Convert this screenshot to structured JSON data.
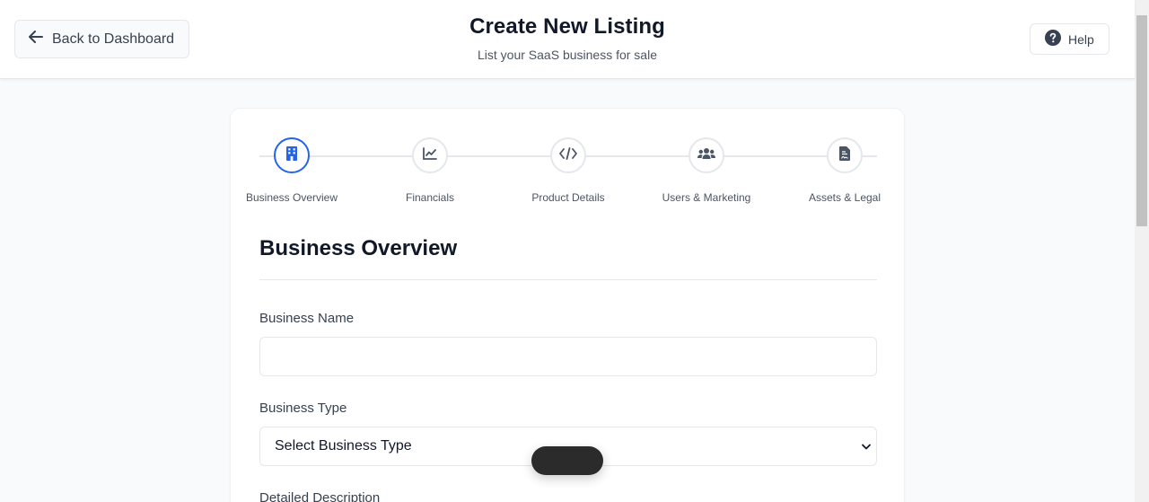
{
  "header": {
    "back_label": "Back to Dashboard",
    "title": "Create New Listing",
    "subtitle": "List your SaaS business for sale",
    "help_label": "Help"
  },
  "stepper": {
    "active_index": 0,
    "steps": [
      {
        "label": "Business Overview",
        "icon": "building-icon"
      },
      {
        "label": "Financials",
        "icon": "chart-line-icon"
      },
      {
        "label": "Product Details",
        "icon": "code-icon"
      },
      {
        "label": "Users & Marketing",
        "icon": "users-icon"
      },
      {
        "label": "Assets & Legal",
        "icon": "file-contract-icon"
      }
    ]
  },
  "section": {
    "title": "Business Overview",
    "fields": {
      "business_name_label": "Business Name",
      "business_name_value": "",
      "business_type_label": "Business Type",
      "business_type_selected": "Select Business Type",
      "description_label": "Detailed Description"
    }
  },
  "colors": {
    "accent": "#2563eb",
    "border": "#e5e7eb",
    "text": "#111827",
    "muted": "#4b5563"
  }
}
